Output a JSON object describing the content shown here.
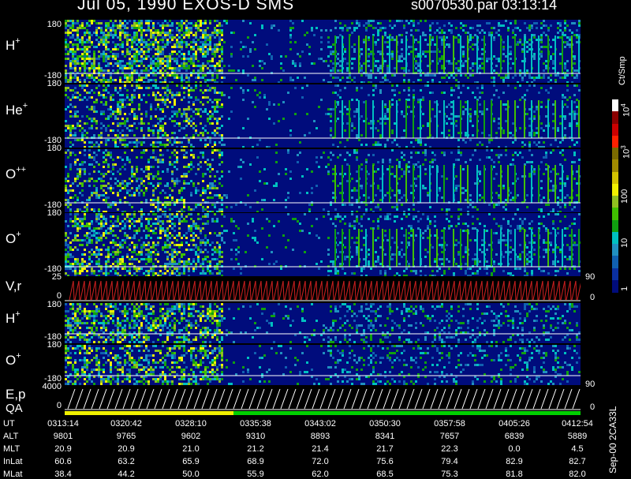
{
  "header": {
    "title": "Jul 05, 1990   EXOS-D SMS",
    "file_time": "s0070530.par   03:13:14"
  },
  "panels": {
    "p1": {
      "label": "H",
      "sup": "+",
      "top": "180",
      "bottom": "-180"
    },
    "p2": {
      "label": "He",
      "sup": "+",
      "top": "180",
      "bottom": "-180"
    },
    "p3": {
      "label": "O",
      "sup": "++",
      "top": "180",
      "bottom": "-180"
    },
    "p4": {
      "label": "O",
      "sup": "+",
      "top": "180",
      "bottom": "-180"
    },
    "p5": {
      "label": "V,r",
      "top": "25",
      "bottom": "0",
      "right_top": "90",
      "right_bottom": "0"
    },
    "p6": {
      "label": "H",
      "sup": "+",
      "top": "180",
      "bottom": "-180"
    },
    "p7": {
      "label": "O",
      "sup": "+",
      "top": "180",
      "bottom": "-180"
    },
    "p8": {
      "label": "E,p",
      "label2": "QA",
      "top": "4000",
      "bottom": "0",
      "right_top": "90",
      "right_bottom": "0"
    }
  },
  "colorbar": {
    "units": "Ct/Smp",
    "ticks": [
      "10",
      "10",
      "100",
      "10",
      "1"
    ],
    "tick_exp": [
      "4",
      "3",
      "",
      "",
      ""
    ],
    "colors": [
      "#ffffff",
      "#8b0000",
      "#cc0000",
      "#ff2000",
      "#7a6a00",
      "#a08a00",
      "#d4c400",
      "#f0f000",
      "#90c020",
      "#40c000",
      "#10a010",
      "#00c0c0",
      "#2090c0",
      "#1060b0",
      "#0a30a0",
      "#000c7c"
    ]
  },
  "side_note": "Sep-00 2CA33L",
  "table": {
    "row_labels": [
      "UT",
      "ALT",
      "MLT",
      "InLat",
      "MLat"
    ],
    "columns": [
      [
        "0313:14",
        "9801",
        "20.9",
        "60.6",
        "38.4"
      ],
      [
        "0320:42",
        "9765",
        "20.9",
        "63.2",
        "44.2"
      ],
      [
        "0328:10",
        "9602",
        "21.0",
        "65.9",
        "50.0"
      ],
      [
        "0335:38",
        "9310",
        "21.2",
        "68.9",
        "55.9"
      ],
      [
        "0343:02",
        "8893",
        "21.4",
        "72.0",
        "62.0"
      ],
      [
        "0350:30",
        "8341",
        "21.7",
        "75.6",
        "68.5"
      ],
      [
        "0357:58",
        "7657",
        "22.3",
        "79.4",
        "75.3"
      ],
      [
        "0405:26",
        "6839",
        "0.0",
        "82.9",
        "81.8"
      ],
      [
        "0412:54",
        "5889",
        "4.5",
        "82.7",
        "82.0"
      ]
    ]
  },
  "chart_data": {
    "type": "heatmap",
    "title": "Jul 05, 1990   EXOS-D SMS",
    "x_ticks": [
      "0313:14",
      "0320:42",
      "0328:10",
      "0335:38",
      "0343:02",
      "0350:30",
      "0357:58",
      "0405:26",
      "0412:54"
    ],
    "panels": [
      "H+",
      "He+",
      "O++",
      "O+",
      "V,r",
      "H+",
      "O+",
      "E,p"
    ],
    "y_range": [
      -180,
      180
    ],
    "color_scale": "log",
    "color_range": [
      1,
      10000
    ],
    "color_units": "Ct/Smp"
  }
}
